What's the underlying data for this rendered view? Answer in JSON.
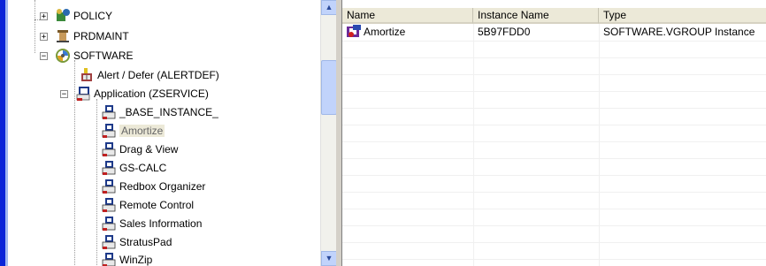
{
  "tree": {
    "items": [
      {
        "label": "POLICY",
        "icon": "policy-icon"
      },
      {
        "label": "PRDMAINT",
        "icon": "prdmaint-icon"
      },
      {
        "label": "SOFTWARE",
        "icon": "software-cd-icon"
      },
      {
        "label": "Alert / Defer (ALERTDEF)",
        "icon": "alert-defer-icon"
      },
      {
        "label": "Application (ZSERVICE)",
        "icon": "application-class-icon"
      },
      {
        "label": "_BASE_INSTANCE_",
        "icon": "instance-icon"
      },
      {
        "label": "Amortize",
        "icon": "instance-icon"
      },
      {
        "label": "Drag & View",
        "icon": "instance-icon"
      },
      {
        "label": "GS-CALC",
        "icon": "instance-icon"
      },
      {
        "label": "Redbox Organizer",
        "icon": "instance-icon"
      },
      {
        "label": "Remote Control",
        "icon": "instance-icon"
      },
      {
        "label": "Sales Information",
        "icon": "instance-icon"
      },
      {
        "label": "StratusPad",
        "icon": "instance-icon"
      },
      {
        "label": "WinZip",
        "icon": "instance-icon"
      }
    ],
    "expanders": {
      "plus": "+",
      "minus": "−"
    }
  },
  "scrollbar": {
    "up": "▲",
    "down": "▼"
  },
  "list": {
    "columns": [
      "Name",
      "Instance Name",
      "Type"
    ],
    "rows": [
      {
        "name": "Amortize",
        "instance_name": "5B97FDD0",
        "type": "SOFTWARE.VGROUP Instance"
      }
    ]
  },
  "colors": {
    "accent_strip": "#0a24d8",
    "header_bg": "#ece9d8",
    "scroll_blue": "#c1d3fb"
  }
}
